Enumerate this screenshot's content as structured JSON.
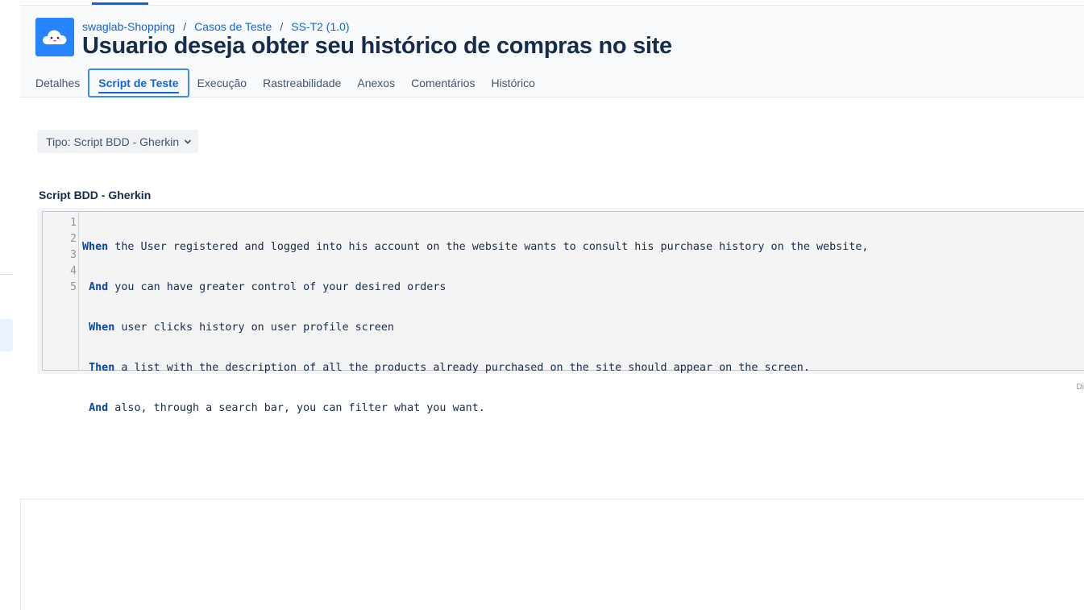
{
  "breadcrumb": {
    "project": "swaglab-Shopping",
    "separator": "/",
    "section": "Casos de Teste",
    "item": "SS-T2 (1.0)"
  },
  "page": {
    "title": "Usuario deseja obter seu histórico de compras no site",
    "avatar_icon": "cloud-mascot-icon"
  },
  "tabs": [
    {
      "label": "Detalhes",
      "active": false
    },
    {
      "label": "Script de Teste",
      "active": true
    },
    {
      "label": "Execução",
      "active": false
    },
    {
      "label": "Rastreabilidade",
      "active": false
    },
    {
      "label": "Anexos",
      "active": false
    },
    {
      "label": "Comentários",
      "active": false
    },
    {
      "label": "Histórico",
      "active": false
    }
  ],
  "script": {
    "type_select": "Tipo: Script BDD - Gherkin",
    "section_label": "Script BDD - Gherkin",
    "line_numbers": [
      "1",
      "2",
      "3",
      "4",
      "5"
    ],
    "lines": [
      {
        "indent": "",
        "keyword": "When",
        "text": " the User registered and logged into his account on the website wants to consult his purchase history on the website,"
      },
      {
        "indent": " ",
        "keyword": "And",
        "text": " you can have greater control of your desired orders"
      },
      {
        "indent": " ",
        "keyword": "When",
        "text": " user clicks history on user profile screen"
      },
      {
        "indent": " ",
        "keyword": "Then",
        "text": " a list with the description of all the products already purchased on the site should appear on the screen."
      },
      {
        "indent": " ",
        "keyword": "And",
        "text": " also, through a search bar, you can filter what you want."
      }
    ],
    "helper_text": "Di"
  },
  "colors": {
    "accent": "#0c66e4",
    "avatar_bg": "#2684ff",
    "keyword": "#0747a6"
  }
}
